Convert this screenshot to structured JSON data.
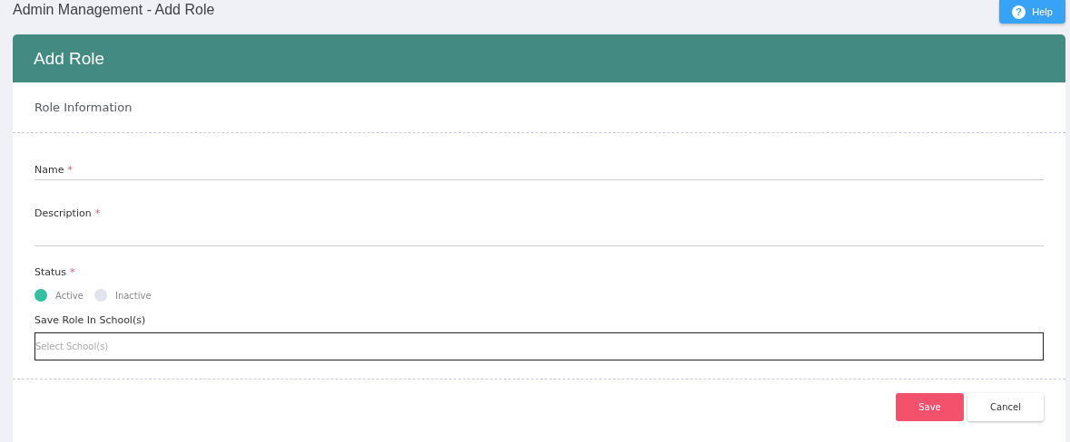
{
  "page_title": "Admin Management - Add Role",
  "help_button": {
    "label": "Help",
    "icon": "?"
  },
  "card": {
    "title": "Add Role",
    "section": "Role Information",
    "fields": [
      {
        "kind": "text",
        "label": "Name",
        "required_mark": "*"
      },
      {
        "kind": "textarea",
        "label": "Description",
        "required_mark": "*"
      },
      {
        "kind": "radio",
        "label": "Status",
        "required_mark": "*",
        "options": [
          {
            "label": "Active",
            "selected": true
          },
          {
            "label": "Inactive",
            "selected": false
          }
        ]
      },
      {
        "kind": "select",
        "label": "Save Role In School(s)",
        "placeholder": "Select School(s)"
      }
    ],
    "buttons": [
      {
        "kind": "primary",
        "label": "Save"
      },
      {
        "kind": "secondary",
        "label": "Cancel"
      }
    ]
  }
}
